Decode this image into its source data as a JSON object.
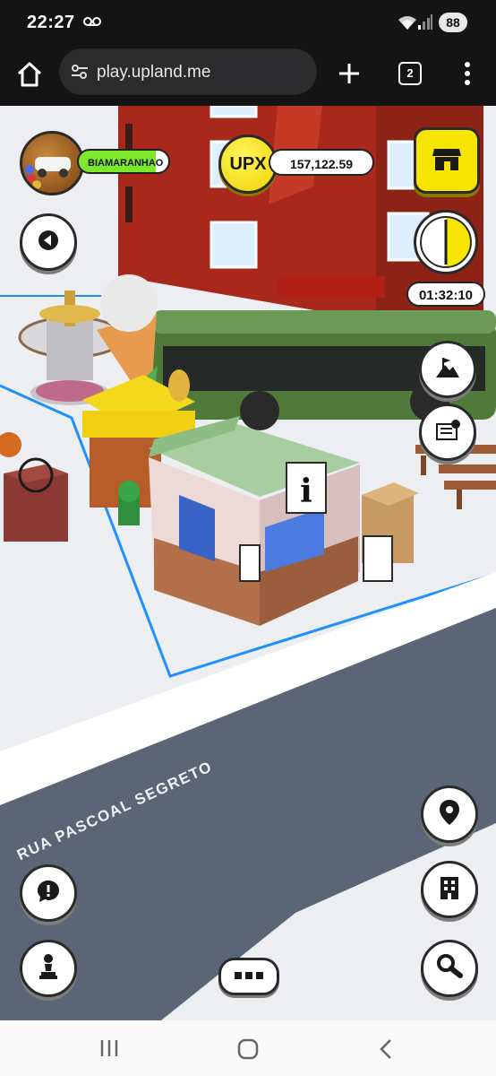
{
  "status_bar": {
    "time": "22:27",
    "battery": "88",
    "icons": [
      "voicemail-icon",
      "wifi-icon",
      "signal-icon"
    ]
  },
  "browser": {
    "url": "play.upland.me",
    "tab_count": "2",
    "icons": [
      "home-icon",
      "tune-icon",
      "plus-icon",
      "more-vert-icon"
    ]
  },
  "game": {
    "username": "BIAMARANHAO",
    "upx_label": "UPX",
    "upx_balance": "157,122.59",
    "timer": "01:32:10",
    "street_name": "RUA PASCOAL SEGRETO",
    "info_sign": "i",
    "colors": {
      "accent_yellow": "#f7e500",
      "bus_green": "#4f7a3a",
      "building_red": "#a8291c",
      "road": "#5a6676",
      "boundary_blue": "#1e90ff"
    },
    "buttons": {
      "left": [
        "back-icon",
        "help-bubble-icon",
        "chess-pawn-icon"
      ],
      "right": [
        "store-icon",
        "landmark-icon",
        "certificate-icon",
        "location-pin-icon",
        "building-icon",
        "search-icon"
      ],
      "bottom": [
        "more-horizontal-icon"
      ]
    }
  },
  "nav_bar": {
    "icons": [
      "recent-apps-icon",
      "home-circle-icon",
      "back-chevron-icon"
    ]
  }
}
